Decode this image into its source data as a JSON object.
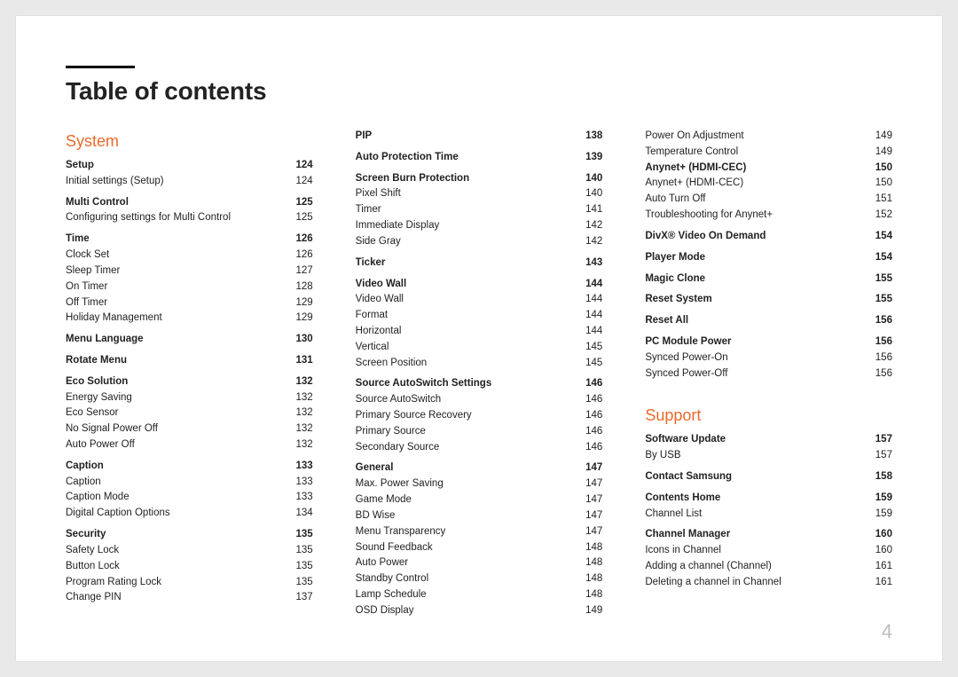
{
  "title": "Table of contents",
  "page_number": "4",
  "sections": [
    {
      "heading": "System",
      "entries": [
        {
          "t": "Setup",
          "p": "124",
          "bold": true
        },
        {
          "t": "Initial settings (Setup)",
          "p": "124"
        },
        {
          "t": "Multi Control",
          "p": "125",
          "bold": true
        },
        {
          "t": "Configuring settings for Multi Control",
          "p": "125"
        },
        {
          "t": "Time",
          "p": "126",
          "bold": true
        },
        {
          "t": "Clock Set",
          "p": "126"
        },
        {
          "t": "Sleep Timer",
          "p": "127"
        },
        {
          "t": "On Timer",
          "p": "128"
        },
        {
          "t": "Off Timer",
          "p": "129"
        },
        {
          "t": "Holiday Management",
          "p": "129"
        },
        {
          "t": "Menu Language",
          "p": "130",
          "bold": true
        },
        {
          "t": "Rotate Menu",
          "p": "131",
          "bold": true
        },
        {
          "t": "Eco Solution",
          "p": "132",
          "bold": true
        },
        {
          "t": "Energy Saving",
          "p": "132"
        },
        {
          "t": "Eco Sensor",
          "p": "132"
        },
        {
          "t": "No Signal Power Off",
          "p": "132"
        },
        {
          "t": "Auto Power Off",
          "p": "132"
        },
        {
          "t": "Caption",
          "p": "133",
          "bold": true
        },
        {
          "t": "Caption",
          "p": "133"
        },
        {
          "t": "Caption Mode",
          "p": "133"
        },
        {
          "t": "Digital Caption Options",
          "p": "134"
        },
        {
          "t": "Security",
          "p": "135",
          "bold": true
        },
        {
          "t": "Safety Lock",
          "p": "135"
        },
        {
          "t": "Button Lock",
          "p": "135"
        },
        {
          "t": "Program Rating Lock",
          "p": "135"
        },
        {
          "t": "Change PIN",
          "p": "137"
        },
        {
          "t": "PIP",
          "p": "138",
          "bold": true,
          "colbreak": true
        },
        {
          "t": "Auto Protection Time",
          "p": "139",
          "bold": true
        },
        {
          "t": "Screen Burn Protection",
          "p": "140",
          "bold": true
        },
        {
          "t": "Pixel Shift",
          "p": "140"
        },
        {
          "t": "Timer",
          "p": "141"
        },
        {
          "t": "Immediate Display",
          "p": "142"
        },
        {
          "t": "Side Gray",
          "p": "142"
        },
        {
          "t": "Ticker",
          "p": "143",
          "bold": true
        },
        {
          "t": "Video Wall",
          "p": "144",
          "bold": true
        },
        {
          "t": "Video Wall",
          "p": "144"
        },
        {
          "t": "Format",
          "p": "144"
        },
        {
          "t": "Horizontal",
          "p": "144"
        },
        {
          "t": "Vertical",
          "p": "145"
        },
        {
          "t": "Screen Position",
          "p": "145"
        },
        {
          "t": "Source AutoSwitch Settings",
          "p": "146",
          "bold": true
        },
        {
          "t": "Source AutoSwitch",
          "p": "146"
        },
        {
          "t": "Primary Source Recovery",
          "p": "146"
        },
        {
          "t": "Primary Source",
          "p": "146"
        },
        {
          "t": "Secondary Source",
          "p": "146"
        },
        {
          "t": "General",
          "p": "147",
          "bold": true
        },
        {
          "t": "Max. Power Saving",
          "p": "147"
        },
        {
          "t": "Game Mode",
          "p": "147"
        },
        {
          "t": "BD Wise",
          "p": "147"
        },
        {
          "t": "Menu Transparency",
          "p": "147"
        },
        {
          "t": "Sound Feedback",
          "p": "148"
        },
        {
          "t": "Auto Power",
          "p": "148"
        },
        {
          "t": "Standby Control",
          "p": "148"
        },
        {
          "t": "Lamp Schedule",
          "p": "148"
        },
        {
          "t": "OSD Display",
          "p": "149"
        },
        {
          "t": "Power On Adjustment",
          "p": "149",
          "colbreak": true
        },
        {
          "t": "Temperature Control",
          "p": "149"
        },
        {
          "t": "Anynet+ (HDMI-CEC)",
          "p": "150",
          "bold": true
        },
        {
          "t": "Anynet+ (HDMI-CEC)",
          "p": "150"
        },
        {
          "t": "Auto Turn Off",
          "p": "151"
        },
        {
          "t": "Troubleshooting for Anynet+",
          "p": "152"
        },
        {
          "t": "DivX® Video On Demand",
          "p": "154",
          "bold": true
        },
        {
          "t": "Player Mode",
          "p": "154",
          "bold": true
        },
        {
          "t": "Magic Clone",
          "p": "155",
          "bold": true
        },
        {
          "t": "Reset System",
          "p": "155",
          "bold": true
        },
        {
          "t": "Reset All",
          "p": "156",
          "bold": true
        },
        {
          "t": "PC Module Power",
          "p": "156",
          "bold": true
        },
        {
          "t": "Synced Power-On",
          "p": "156"
        },
        {
          "t": "Synced Power-Off",
          "p": "156"
        }
      ]
    },
    {
      "heading": "Support",
      "entries": [
        {
          "t": "Software Update",
          "p": "157",
          "bold": true
        },
        {
          "t": "By USB",
          "p": "157"
        },
        {
          "t": "Contact Samsung",
          "p": "158",
          "bold": true
        },
        {
          "t": "Contents Home",
          "p": "159",
          "bold": true
        },
        {
          "t": "Channel List",
          "p": "159"
        },
        {
          "t": "Channel Manager",
          "p": "160",
          "bold": true
        },
        {
          "t": "Icons in Channel",
          "p": "160"
        },
        {
          "t": "Adding a channel (Channel)",
          "p": "161"
        },
        {
          "t": "Deleting a channel in Channel",
          "p": "161"
        }
      ]
    }
  ]
}
